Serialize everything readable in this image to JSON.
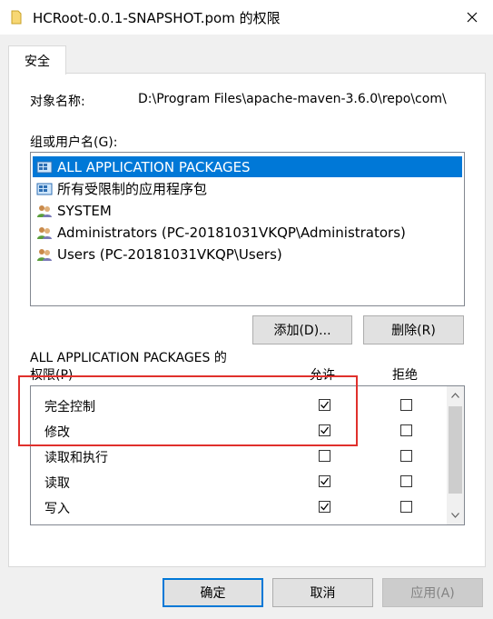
{
  "window": {
    "title": "HCRoot-0.0.1-SNAPSHOT.pom 的权限",
    "close_icon": "close-icon"
  },
  "tabs": [
    {
      "label": "安全",
      "selected": true
    }
  ],
  "object": {
    "label": "对象名称:",
    "value": "D:\\Program Files\\apache-maven-3.6.0\\repo\\com\\"
  },
  "groups": {
    "label": "组或用户名(G):",
    "items": [
      {
        "name": "ALL APPLICATION PACKAGES",
        "icon": "app-package-icon",
        "selected": true
      },
      {
        "name": "所有受限制的应用程序包",
        "icon": "app-package-icon",
        "selected": false
      },
      {
        "name": "SYSTEM",
        "icon": "users-icon",
        "selected": false
      },
      {
        "name": "Administrators (PC-20181031VKQP\\Administrators)",
        "icon": "users-icon",
        "selected": false
      },
      {
        "name": "Users (PC-20181031VKQP\\Users)",
        "icon": "users-icon",
        "selected": false
      }
    ],
    "add_button": "添加(D)...",
    "remove_button": "删除(R)"
  },
  "permissions": {
    "header_line1": "ALL APPLICATION PACKAGES 的",
    "header_line2": "权限(P)",
    "allow_label": "允许",
    "deny_label": "拒绝",
    "rows": [
      {
        "name": "完全控制",
        "allow": true,
        "deny": false
      },
      {
        "name": "修改",
        "allow": true,
        "deny": false
      },
      {
        "name": "读取和执行",
        "allow": false,
        "deny": false
      },
      {
        "name": "读取",
        "allow": true,
        "deny": false
      },
      {
        "name": "写入",
        "allow": true,
        "deny": false
      }
    ]
  },
  "footer": {
    "ok": "确定",
    "cancel": "取消",
    "apply": "应用(A)"
  },
  "colors": {
    "selection": "#0078d7",
    "highlight_box": "#e0302c"
  }
}
